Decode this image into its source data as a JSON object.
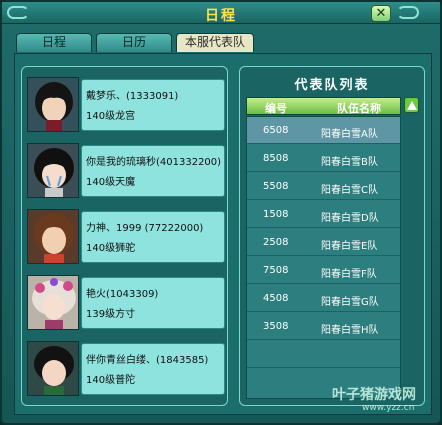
{
  "window": {
    "title": "日程",
    "close_glyph": "✕"
  },
  "tabs": [
    {
      "label": "日程",
      "active": false
    },
    {
      "label": "日历",
      "active": false
    },
    {
      "label": "本服代表队",
      "active": true
    }
  ],
  "members": [
    {
      "name": "戴梦乐、(1333091)",
      "level": "140级龙宫"
    },
    {
      "name": "你是我的琉璃秒(401332200)",
      "level": "140级天魔"
    },
    {
      "name": "力神、1999 (77222000)",
      "level": "140级狮驼"
    },
    {
      "name": "艳火(1043309)",
      "level": "139级方寸"
    },
    {
      "name": "伴你青丝白缕、(1843585)",
      "level": "140级普陀"
    }
  ],
  "team_list": {
    "title": "代表队列表",
    "headers": [
      "编号",
      "队伍名称"
    ],
    "rows": [
      {
        "id": "6508",
        "name": "阳春白雪A队",
        "selected": true
      },
      {
        "id": "8508",
        "name": "阳春白雪B队"
      },
      {
        "id": "5508",
        "name": "阳春白雪C队"
      },
      {
        "id": "1508",
        "name": "阳春白雪D队"
      },
      {
        "id": "2508",
        "name": "阳春白雪E队"
      },
      {
        "id": "7508",
        "name": "阳春白雪F队"
      },
      {
        "id": "4508",
        "name": "阳春白雪G队"
      },
      {
        "id": "3508",
        "name": "阳春白雪H队"
      }
    ]
  },
  "watermark": {
    "text": "叶子猪游戏网",
    "url": "www.yzz.cn"
  },
  "colors": {
    "title": "#ffe24a",
    "panel_border": "#7fd7cb",
    "info_bg": "#8fe3df",
    "selected_row": "#5f96a6"
  },
  "icons": [
    "swirl-ornament-icon",
    "close-icon",
    "scroll-up-icon"
  ]
}
